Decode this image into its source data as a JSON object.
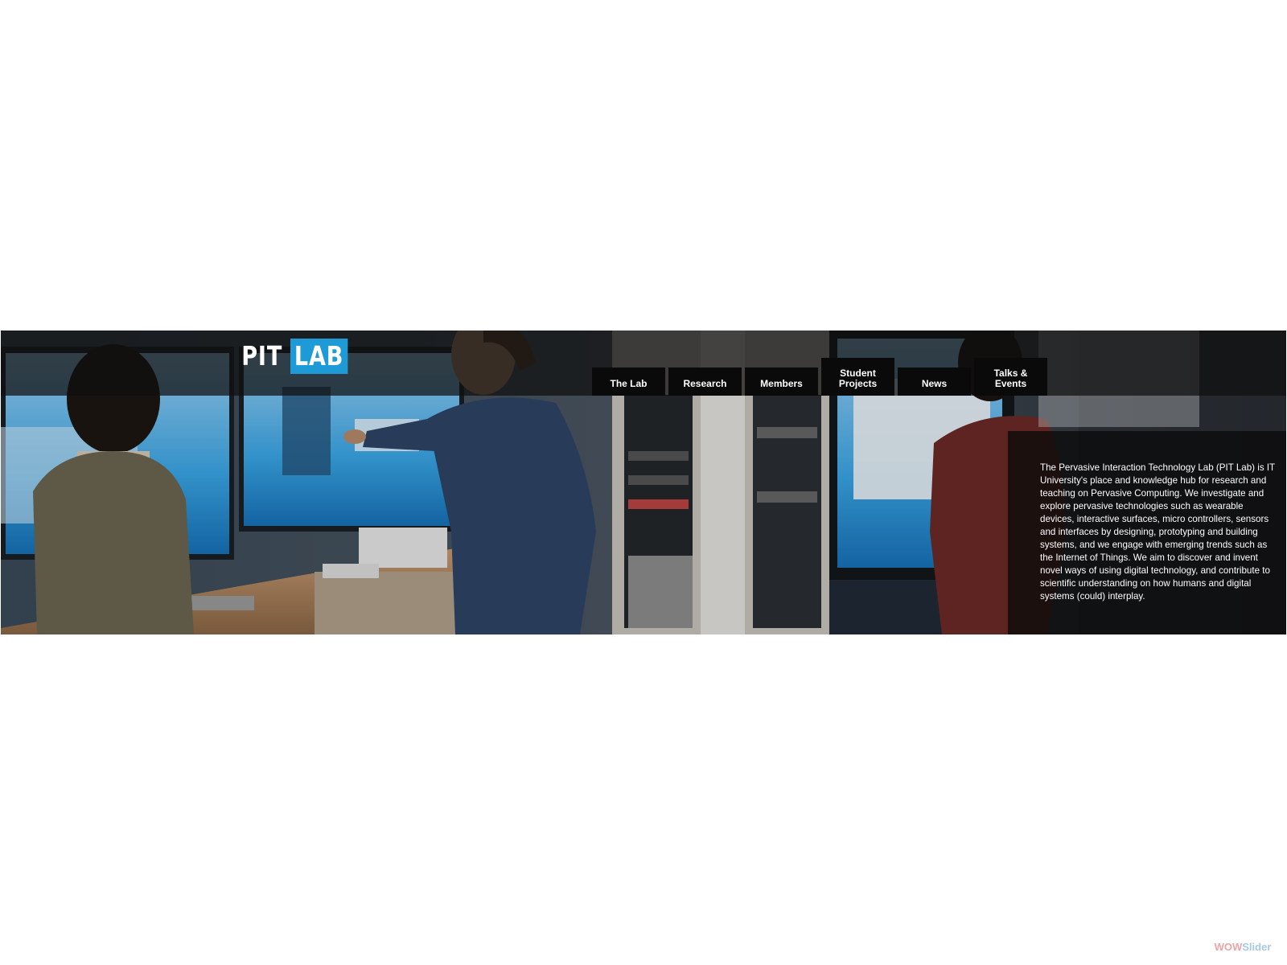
{
  "logo": {
    "part1": "PIT",
    "part2": "LAB",
    "accent_color": "#1e9ad6"
  },
  "nav": {
    "items": [
      {
        "label": "The Lab"
      },
      {
        "label": "Research"
      },
      {
        "label": "Members"
      },
      {
        "label": "Student Projects"
      },
      {
        "label": "News"
      },
      {
        "label": "Talks & Events"
      }
    ]
  },
  "description": {
    "text": "The Pervasive Interaction Technology Lab (PIT Lab) is IT University's place and knowledge hub for research and teaching on Pervasive Computing. We investigate and explore pervasive technologies such as wearable devices, interactive surfaces, micro controllers, sensors and interfaces by designing, prototyping and building systems, and we engage with emerging trends such as the Internet of Things. We aim to discover and invent novel ways of using digital technology, and contribute to scientific understanding on how humans and digital systems (could) interplay."
  },
  "watermark": {
    "part1": "WOW",
    "part2": "Slider"
  }
}
